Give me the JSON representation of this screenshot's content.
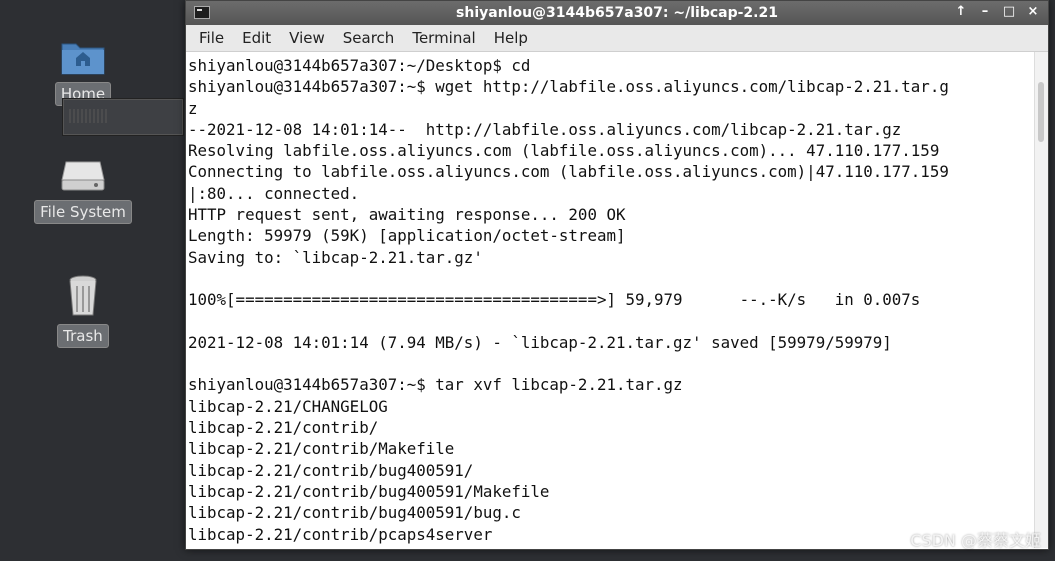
{
  "desktop": {
    "icons": [
      {
        "label": "Home",
        "icon": "folder-home-icon"
      },
      {
        "label": "File System",
        "icon": "drive-icon"
      },
      {
        "label": "Trash",
        "icon": "trash-icon"
      }
    ]
  },
  "window": {
    "title": "shiyanlou@3144b657a307: ~/libcap-2.21",
    "controls": [
      "↑",
      "–",
      "□",
      "×"
    ],
    "menu": [
      "File",
      "Edit",
      "View",
      "Search",
      "Terminal",
      "Help"
    ]
  },
  "terminal": {
    "lines": [
      "shiyanlou@3144b657a307:~/Desktop$ cd",
      "shiyanlou@3144b657a307:~$ wget http://labfile.oss.aliyuncs.com/libcap-2.21.tar.g",
      "z",
      "--2021-12-08 14:01:14--  http://labfile.oss.aliyuncs.com/libcap-2.21.tar.gz",
      "Resolving labfile.oss.aliyuncs.com (labfile.oss.aliyuncs.com)... 47.110.177.159",
      "Connecting to labfile.oss.aliyuncs.com (labfile.oss.aliyuncs.com)|47.110.177.159",
      "|:80... connected.",
      "HTTP request sent, awaiting response... 200 OK",
      "Length: 59979 (59K) [application/octet-stream]",
      "Saving to: `libcap-2.21.tar.gz'",
      "",
      "100%[======================================>] 59,979      --.-K/s   in 0.007s",
      "",
      "2021-12-08 14:01:14 (7.94 MB/s) - `libcap-2.21.tar.gz' saved [59979/59979]",
      "",
      "shiyanlou@3144b657a307:~$ tar xvf libcap-2.21.tar.gz",
      "libcap-2.21/CHANGELOG",
      "libcap-2.21/contrib/",
      "libcap-2.21/contrib/Makefile",
      "libcap-2.21/contrib/bug400591/",
      "libcap-2.21/contrib/bug400591/Makefile",
      "libcap-2.21/contrib/bug400591/bug.c",
      "libcap-2.21/contrib/pcaps4server"
    ]
  },
  "watermark": "CSDN @蔡蔡文姬"
}
